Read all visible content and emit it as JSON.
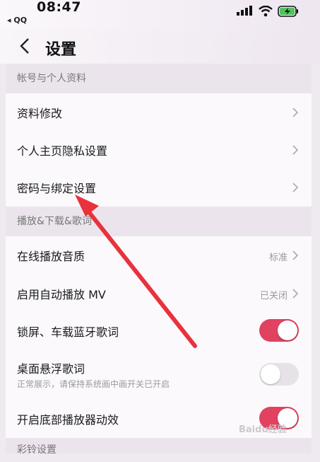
{
  "status_bar": {
    "time": "08:47",
    "back_app": "◂ QQ",
    "signal_icon": "signal-bars-icon",
    "wifi_icon": "wifi-icon",
    "battery_icon": "battery-charging-icon"
  },
  "nav": {
    "title": "设置",
    "back_icon": "chevron-left-icon"
  },
  "sections": {
    "account": {
      "header": "帐号与个人资料",
      "items": [
        {
          "label": "资料修改"
        },
        {
          "label": "个人主页隐私设置"
        },
        {
          "label": "密码与绑定设置"
        }
      ]
    },
    "playback": {
      "header": "播放&下载&歌词",
      "items": [
        {
          "label": "在线播放音质",
          "value": "标准"
        },
        {
          "label": "启用自动播放 MV",
          "value": "已关闭"
        },
        {
          "label": "锁屏、车载蓝牙歌词",
          "toggle": true
        },
        {
          "label": "桌面悬浮歌词",
          "sublabel": "正常展示，请保持系统画中画开关已开启",
          "toggle": false
        },
        {
          "label": "开启底部播放器动效",
          "toggle": true
        }
      ]
    },
    "ringtone": {
      "header": "彩铃设置"
    }
  },
  "annotation": {
    "arrow_color": "#e8323c"
  },
  "watermark": "Baidu经验"
}
